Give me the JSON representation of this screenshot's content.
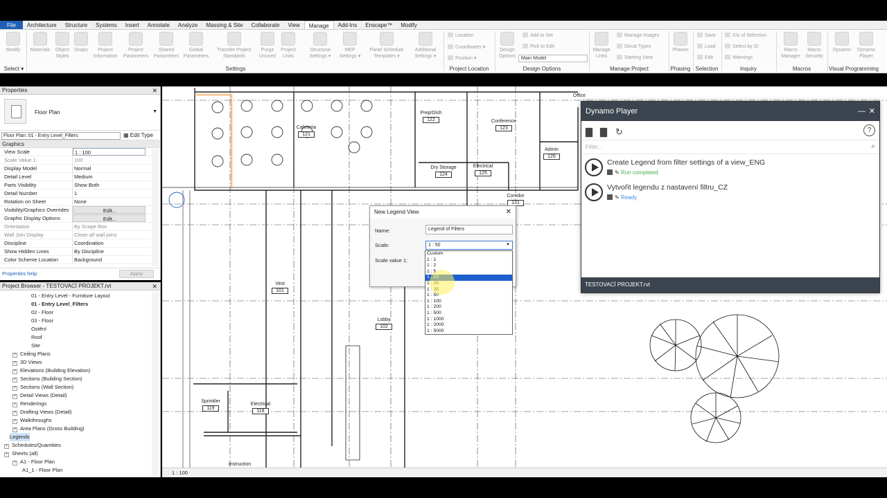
{
  "tabs": [
    "File",
    "Architecture",
    "Structure",
    "Systems",
    "Insert",
    "Annotate",
    "Analyze",
    "Massing & Site",
    "Collaborate",
    "View",
    "Manage",
    "Add-Ins",
    "Enscape™",
    "Modify"
  ],
  "active_tab": "Manage",
  "ribbon": {
    "modify": "Modify",
    "select": "Select ▾",
    "materials": "Materials",
    "object_styles": "Object Styles",
    "snaps": "Snaps",
    "project_information": "Project Information",
    "project_parameters": "Project Parameters",
    "shared_parameters": "Shared Parameters",
    "global_parameters": "Global Parameters",
    "transfer_project_standards": "Transfer Project Standards",
    "purge_unused": "Purge Unused",
    "project_units": "Project Units",
    "structural_settings": "Structural Settings ▾",
    "mep_settings": "MEP Settings ▾",
    "panel_schedule_templates": "Panel Schedule Templates ▾",
    "additional_settings": "Additional Settings ▾",
    "location": "Location",
    "coordinates": "Coordinates ▾",
    "position": "Position ▾",
    "design_options": "Design Options",
    "add_to_set": "Add to Set",
    "pick_to_edit": "Pick to Edit",
    "main_model": "Main Model",
    "manage_links": "Manage Links",
    "manage_images": "Manage Images",
    "decal_types": "Decal Types",
    "starting_view": "Starting View",
    "phases": "Phases",
    "save": "Save",
    "load": "Load",
    "edit": "Edit",
    "ids_of_selection": "IDs of Selection",
    "select_by_id": "Select by ID",
    "warnings": "Warnings",
    "macro_manager": "Macro Manager",
    "macro_security": "Macro Security",
    "dynamo": "Dynamo",
    "dynamo_player": "Dynamo Player",
    "groups": {
      "settings": "Settings",
      "project_location": "Project Location",
      "design_options": "Design Options",
      "manage_project": "Manage Project",
      "phasing": "Phasing",
      "selection": "Selection",
      "inquiry": "Inquiry",
      "macros": "Macros",
      "visual_programming": "Visual Programming"
    }
  },
  "properties": {
    "title": "Properties",
    "type_name": "Floor Plan",
    "instance_selector": "Floor Plan: 01 - Entry Level_Filters",
    "edit_type": "Edit Type",
    "group": "Graphics",
    "rows": [
      {
        "k": "View Scale",
        "v": "1 : 100"
      },
      {
        "k": "Scale Value    1:",
        "v": "100"
      },
      {
        "k": "Display Model",
        "v": "Normal"
      },
      {
        "k": "Detail Level",
        "v": "Medium"
      },
      {
        "k": "Parts Visibility",
        "v": "Show Both"
      },
      {
        "k": "Detail Number",
        "v": "1"
      },
      {
        "k": "Rotation on Sheet",
        "v": "None"
      },
      {
        "k": "Visibility/Graphics Overrides",
        "v": "Edit..."
      },
      {
        "k": "Graphic Display Options",
        "v": "Edit..."
      },
      {
        "k": "Orientation",
        "v": "By Scope Box"
      },
      {
        "k": "Wall Join Display",
        "v": "Clean all wall joins"
      },
      {
        "k": "Discipline",
        "v": "Coordination"
      },
      {
        "k": "Show Hidden Lines",
        "v": "By Discipline"
      },
      {
        "k": "Color Scheme Location",
        "v": "Background"
      }
    ],
    "help": "Properties help",
    "apply": "Apply"
  },
  "browser": {
    "title": "Project Browser - TESTOVACÍ PROJEKT.rvt",
    "items": [
      "01 - Entry Level - Furniture Layout",
      "01 - Entry Level_Filters",
      "02 - Floor",
      "03 - Floor",
      "Ostění",
      "Roof",
      "Site",
      "Ceiling Plans",
      "3D Views",
      "Elevations (Building Elevation)",
      "Sections (Building Section)",
      "Sections (Wall Section)",
      "Detail Views (Detail)",
      "Renderings",
      "Drafting Views (Detail)",
      "Walkthroughs",
      "Area Plans (Gross Building)",
      "Legends",
      "Schedules/Quantities",
      "Sheets (all)",
      "A1 - Floor Plan",
      "A1_1 - Floor Plan"
    ]
  },
  "rooms": [
    {
      "name": "Prep/Dish",
      "num": "122"
    },
    {
      "name": "Conference",
      "num": "123"
    },
    {
      "name": "Cafeteria",
      "num": "121"
    },
    {
      "name": "Admin",
      "num": "126"
    },
    {
      "name": "Dry Storage",
      "num": "124"
    },
    {
      "name": "Electrical",
      "num": "125"
    },
    {
      "name": "Corridor",
      "num": "131"
    },
    {
      "name": "Vest",
      "num": "101"
    },
    {
      "name": "Lobby",
      "num": "102"
    },
    {
      "name": "Sprinkler",
      "num": "119"
    },
    {
      "name": "Electrical",
      "num": "118"
    },
    {
      "name": "Office",
      "num": ""
    },
    {
      "name": "Instruction",
      "num": ""
    }
  ],
  "status_scale": "1 : 100",
  "dialog": {
    "title": "New Legend View",
    "name_label": "Name:",
    "name_value": "Legend of Filters",
    "scale_label": "Scale:",
    "scale_value": "1 : 50",
    "scale_value_label": "Scale value  1:",
    "options": [
      "Custom",
      "1 : 1",
      "1 : 2",
      "1 : 5",
      "1 : 10",
      "1 : 20",
      "1 : 25",
      "1 : 50",
      "1 : 100",
      "1 : 200",
      "1 : 500",
      "1 : 1000",
      "1 : 2000",
      "1 : 5000"
    ],
    "highlighted": "1 : 10"
  },
  "dynamo_player": {
    "title": "Dynamo Player",
    "filter_placeholder": "Filter...",
    "scripts": [
      {
        "name": "Create Legend from filter settings of a view_ENG",
        "status": "Run completed"
      },
      {
        "name": "Vytvořit legendu z nastavení filtru_CZ",
        "status": "Ready"
      }
    ],
    "footer": "TESTOVACÍ PROJEKT.rvt"
  },
  "colors": {
    "file_tab": "#1f5fb6",
    "dynamo_header": "#3c444f",
    "status_done": "#4caf50",
    "status_ready": "#3b8fd8",
    "highlight": "#1f5fcf"
  },
  "icons": [
    "minimize-icon",
    "close-icon",
    "open-folder-icon",
    "folder-settings-icon",
    "refresh-icon",
    "help-icon",
    "search-icon",
    "play-icon",
    "edit-icon"
  ]
}
